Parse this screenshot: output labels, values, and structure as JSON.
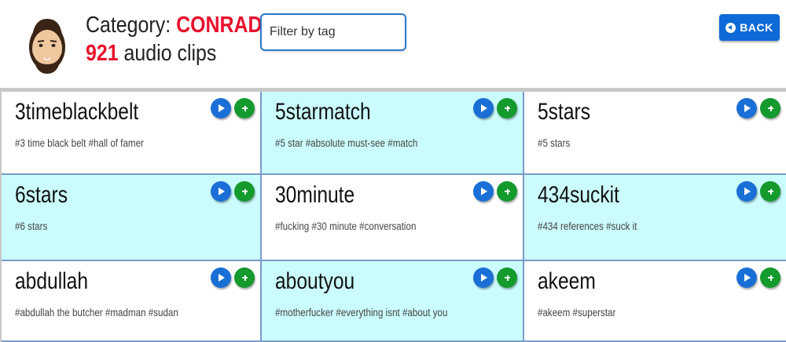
{
  "header": {
    "category_prefix": "Category: ",
    "category_name": "CONRAD",
    "clip_count": "921",
    "clip_count_suffix": " audio clips",
    "avatar_icon": "cartoon-man-face-icon"
  },
  "filter": {
    "placeholder": "Filter by tag",
    "value": ""
  },
  "back_button": {
    "label": "BACK",
    "icon": "circle-arrow-left-icon"
  },
  "colors": {
    "accent_red": "#e8112d",
    "button_blue": "#0d6ad8",
    "play_blue": "#1a6fd6",
    "add_green": "#149a2d",
    "cyan_card": "#cbfcfd"
  },
  "clips": [
    {
      "name": "3timeblackbelt",
      "tags": "#3 time black belt  #hall of famer",
      "highlight": false
    },
    {
      "name": "5starmatch",
      "tags": "#5 star  #absolute must-see  #match",
      "highlight": true
    },
    {
      "name": "5stars",
      "tags": "#5 stars",
      "highlight": false
    },
    {
      "name": "6stars",
      "tags": "#6 stars",
      "highlight": true
    },
    {
      "name": "30minute",
      "tags": "#fucking  #30 minute  #conversation",
      "highlight": false
    },
    {
      "name": "434suckit",
      "tags": "#434 references  #suck it",
      "highlight": true
    },
    {
      "name": "abdullah",
      "tags": "#abdullah the butcher  #madman  #sudan",
      "highlight": false
    },
    {
      "name": "aboutyou",
      "tags": "#motherfucker  #everything isnt  #about you",
      "highlight": true
    },
    {
      "name": "akeem",
      "tags": "#akeem  #superstar",
      "highlight": false
    }
  ]
}
